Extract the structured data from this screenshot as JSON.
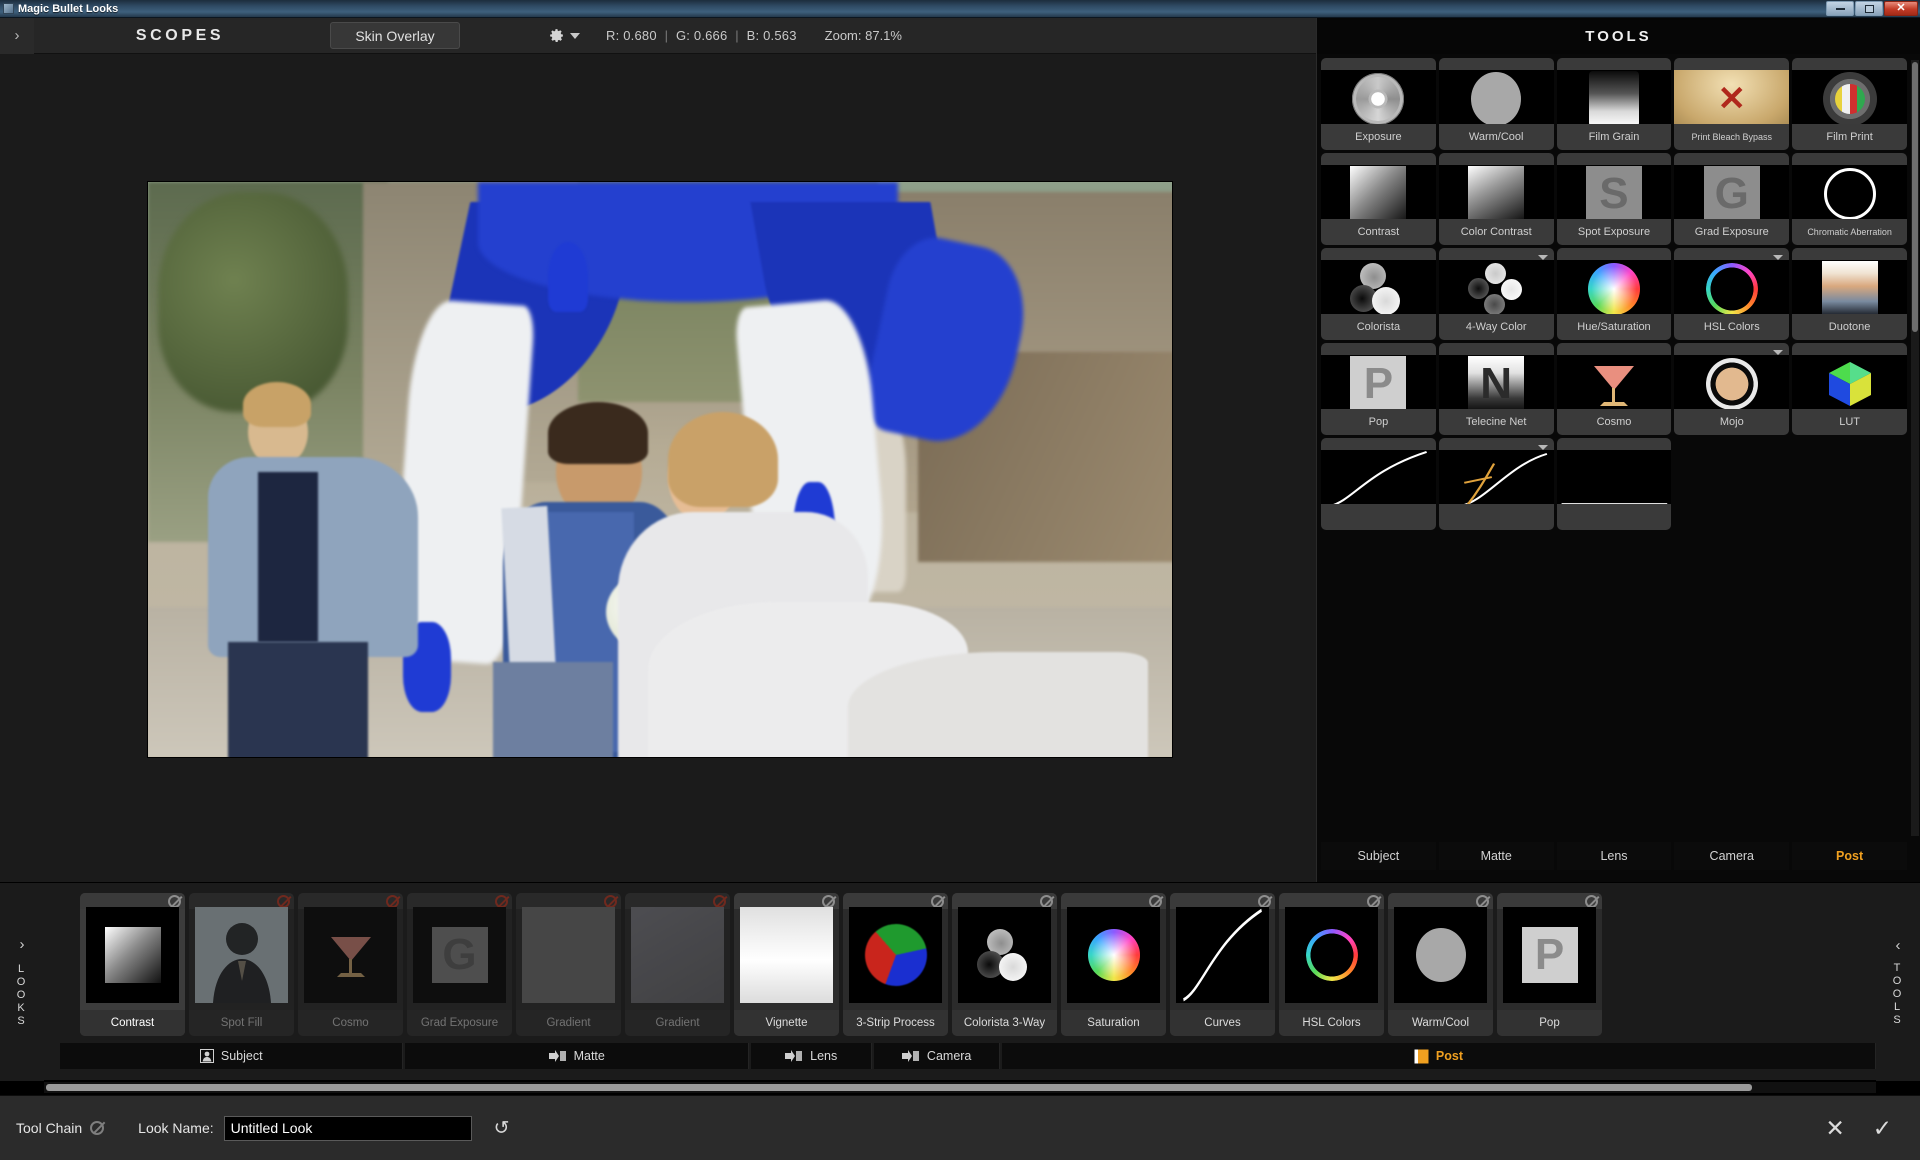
{
  "window": {
    "title": "Magic Bullet Looks",
    "controls": {
      "minimize": "—",
      "maximize": "▣",
      "close": "✕"
    }
  },
  "toolbar": {
    "expand_arrow": "›",
    "scopes_label": "SCOPES",
    "skin_overlay_tab": "Skin Overlay",
    "gear_icon": "gear-icon",
    "dropdown_caret": "▾",
    "readout": {
      "r": "R: 0.680",
      "g": "G: 0.666",
      "b": "B: 0.563",
      "sep": "|"
    },
    "zoom": "Zoom:  87.1%"
  },
  "tools_panel": {
    "title": "TOOLS",
    "items": [
      {
        "label": "Exposure",
        "art": "iris",
        "dropdown": false
      },
      {
        "label": "Warm/Cool",
        "art": "grayball",
        "dropdown": false
      },
      {
        "label": "Film Grain",
        "art": "graincard",
        "dropdown": false
      },
      {
        "label": "Print Bleach Bypass",
        "art": "bleach",
        "dropdown": false,
        "small": true
      },
      {
        "label": "Film Print",
        "art": "filmprint",
        "dropdown": false
      },
      {
        "label": "Contrast",
        "art": "gradcard",
        "dropdown": false
      },
      {
        "label": "Color Contrast",
        "art": "gradcard2",
        "dropdown": false
      },
      {
        "label": "Spot Exposure",
        "art": "letter-S",
        "dropdown": false
      },
      {
        "label": "Grad Exposure",
        "art": "letter-G",
        "dropdown": false
      },
      {
        "label": "Chromatic Aberration",
        "art": "ringwhite",
        "dropdown": false,
        "small": true
      },
      {
        "label": "Colorista",
        "art": "colorista",
        "dropdown": false
      },
      {
        "label": "4-Way Color",
        "art": "fourway",
        "dropdown": true
      },
      {
        "label": "Hue/Saturation",
        "art": "huewheel",
        "dropdown": false
      },
      {
        "label": "HSL Colors",
        "art": "hslring",
        "dropdown": true
      },
      {
        "label": "Duotone",
        "art": "duotone",
        "dropdown": false
      },
      {
        "label": "Pop",
        "art": "letter-P",
        "dropdown": false
      },
      {
        "label": "Telecine Net",
        "art": "letter-N",
        "dropdown": false
      },
      {
        "label": "Cosmo",
        "art": "cosmo",
        "dropdown": false
      },
      {
        "label": "Mojo",
        "art": "mojo",
        "dropdown": true
      },
      {
        "label": "LUT",
        "art": "lutcube",
        "dropdown": false
      },
      {
        "label": "",
        "art": "curve-line",
        "dropdown": false
      },
      {
        "label": "",
        "art": "curve-matte",
        "dropdown": true
      },
      {
        "label": "",
        "art": "curve-flat",
        "dropdown": false
      }
    ],
    "tabs": [
      {
        "label": "Subject",
        "active": false
      },
      {
        "label": "Matte",
        "active": false
      },
      {
        "label": "Lens",
        "active": false
      },
      {
        "label": "Camera",
        "active": false
      },
      {
        "label": "Post",
        "active": true
      }
    ]
  },
  "looks_strip": {
    "left_chevron": "›",
    "left_label": "LOOKS",
    "right_chevron": "‹",
    "right_label": "TOOLS",
    "chips": [
      {
        "label": "Contrast",
        "art": "gradcard",
        "enabled": true,
        "selected": true
      },
      {
        "label": "Spot Fill",
        "art": "subject",
        "enabled": false,
        "selected": false
      },
      {
        "label": "Cosmo",
        "art": "cosmo",
        "enabled": false,
        "selected": false
      },
      {
        "label": "Grad Exposure",
        "art": "letter-G",
        "enabled": false,
        "selected": false
      },
      {
        "label": "Gradient",
        "art": "flatgray",
        "enabled": false,
        "selected": false
      },
      {
        "label": "Gradient",
        "art": "flatgray2",
        "enabled": false,
        "selected": false
      },
      {
        "label": "Vignette",
        "art": "vignette",
        "enabled": true,
        "selected": false
      },
      {
        "label": "3-Strip Process",
        "art": "tristrip",
        "enabled": true,
        "selected": false
      },
      {
        "label": "Colorista 3-Way",
        "art": "colorista",
        "enabled": true,
        "selected": false
      },
      {
        "label": "Saturation",
        "art": "huewheel",
        "enabled": true,
        "selected": false
      },
      {
        "label": "Curves",
        "art": "curve-line",
        "enabled": true,
        "selected": false
      },
      {
        "label": "HSL Colors",
        "art": "hslring",
        "enabled": true,
        "selected": false
      },
      {
        "label": "Warm/Cool",
        "art": "grayball",
        "enabled": true,
        "selected": false
      },
      {
        "label": "Pop",
        "art": "letter-P",
        "enabled": true,
        "selected": false
      }
    ],
    "tabs": [
      {
        "label": "Subject",
        "icon": "subject-icon",
        "active": false
      },
      {
        "label": "Matte",
        "icon": "matte-icon",
        "active": false
      },
      {
        "label": "Lens",
        "icon": "lens-icon",
        "active": false
      },
      {
        "label": "Camera",
        "icon": "camera-icon",
        "active": false
      },
      {
        "label": "Post",
        "icon": "post-icon",
        "active": true
      }
    ]
  },
  "status_bar": {
    "tool_chain_label": "Tool Chain",
    "tool_chain_badge": "disabled-icon",
    "look_name_label": "Look Name:",
    "look_name_value": "Untitled Look",
    "look_name_placeholder": "Untitled Look",
    "reset_icon": "↺",
    "cancel_icon": "✕",
    "accept_icon": "✓"
  },
  "colors": {
    "accent": "#f0a020",
    "panel_bg": "#1b1b1b",
    "tools_bg": "#080808",
    "close_red": "#c23b27"
  }
}
